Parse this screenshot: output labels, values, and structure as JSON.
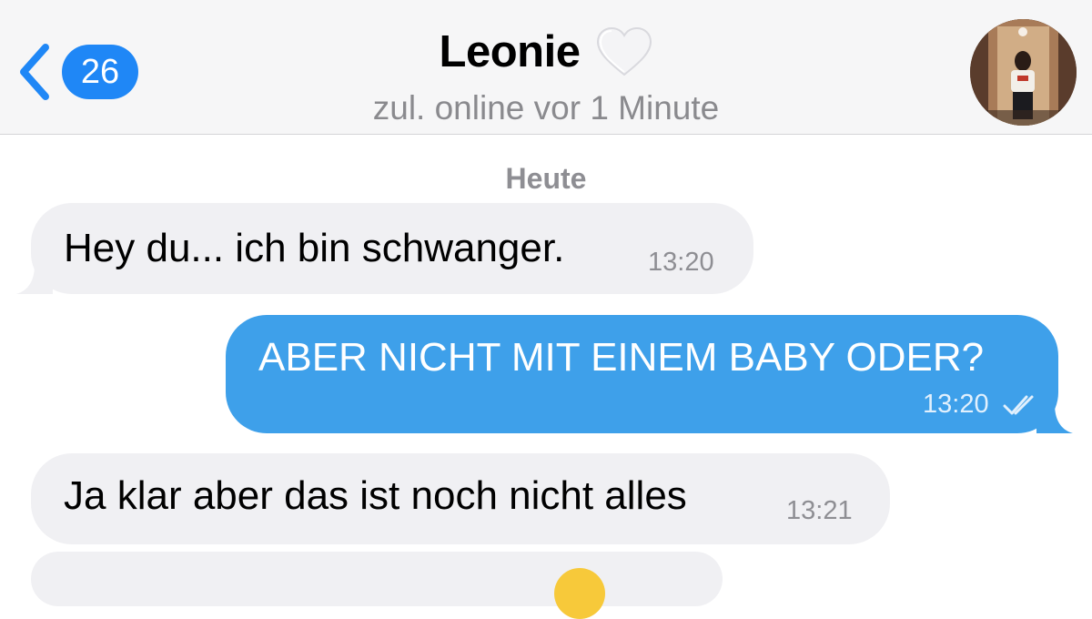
{
  "header": {
    "back_badge_count": "26",
    "title": "Leonie",
    "status": "zul. online vor 1 Minute",
    "title_icon": "white-heart-icon",
    "back_icon": "chevron-left-icon"
  },
  "chat": {
    "date_label": "Heute",
    "messages": [
      {
        "direction": "incoming",
        "text": "Hey du... ich bin schwanger.",
        "time": "13:20"
      },
      {
        "direction": "outgoing",
        "text": "ABER NICHT MIT EINEM BABY ODER?",
        "time": "13:20",
        "status_icon": "double-check-icon"
      },
      {
        "direction": "incoming",
        "text": "Ja klar aber das ist noch nicht alles",
        "time": "13:21"
      }
    ]
  },
  "colors": {
    "accent": "#1f87f6",
    "outgoing_bubble": "#3ea0ea",
    "incoming_bubble": "#f0f0f3",
    "header_background": "#f6f6f7"
  }
}
